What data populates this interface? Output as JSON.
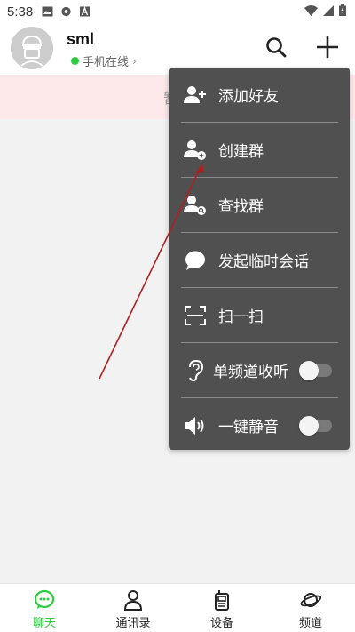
{
  "status_bar": {
    "time": "5:38"
  },
  "header": {
    "user_name": "sml",
    "status_text": "手机在线",
    "chevron": "›"
  },
  "notice": {
    "text": "暂无"
  },
  "menu": {
    "items": [
      {
        "label": "添加好友",
        "icon": "add-friend-icon"
      },
      {
        "label": "创建群",
        "icon": "create-group-icon"
      },
      {
        "label": "查找群",
        "icon": "search-group-icon"
      },
      {
        "label": "发起临时会话",
        "icon": "chat-bubble-icon"
      },
      {
        "label": "扫一扫",
        "icon": "scan-icon"
      },
      {
        "label": "单频道收听",
        "icon": "ear-icon",
        "toggle": false
      },
      {
        "label": "一键静音",
        "icon": "speaker-icon",
        "toggle": false
      }
    ]
  },
  "bottom_nav": {
    "items": [
      {
        "label": "聊天",
        "active": true
      },
      {
        "label": "通讯录",
        "active": false
      },
      {
        "label": "设备",
        "active": false
      },
      {
        "label": "频道",
        "active": false
      }
    ]
  },
  "colors": {
    "accent": "#2ecc40",
    "menu_bg": "#505050",
    "notice_bg": "#fde8ea",
    "arrow": "#b02020"
  }
}
